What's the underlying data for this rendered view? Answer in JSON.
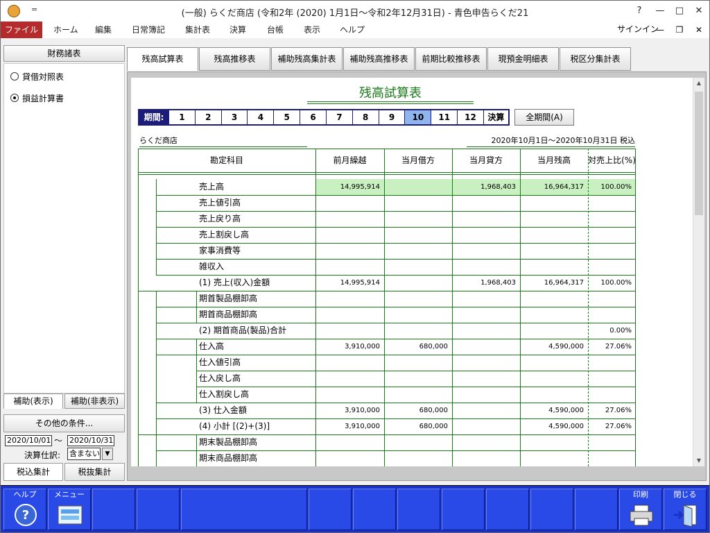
{
  "window": {
    "title": "(一般) らくだ商店 (令和2年 (2020) 1月1日～令和2年12月31日) - 青色申告らくだ21",
    "help_btn": "?",
    "min_btn": "—",
    "max_btn": "□",
    "close_btn": "✕",
    "qat": "="
  },
  "menu": {
    "items": [
      "ファイル",
      "ホーム",
      "編集",
      "日常簿記",
      "集計表",
      "決算",
      "台帳",
      "表示",
      "ヘルプ"
    ],
    "signin": "サインイン",
    "mdi_min": "—",
    "mdi_restore": "❐",
    "mdi_close": "✕"
  },
  "left": {
    "header": "財務諸表",
    "radios": [
      {
        "label": "貸借対照表",
        "selected": false
      },
      {
        "label": "損益計算書",
        "selected": true
      }
    ],
    "tab_show": "補助(表示)",
    "tab_hide": "補助(非表示)",
    "other_conditions": "その他の条件...",
    "date_from": "2020/10/01",
    "tilde": "～",
    "date_to": "2020/10/31",
    "settle_label": "決算仕訳:",
    "settle_value": "含まない",
    "tax_incl": "税込集計",
    "tax_excl": "税抜集計"
  },
  "tabs": [
    "残高試算表",
    "残高推移表",
    "補助残高集計表",
    "補助残高推移表",
    "前期比較推移表",
    "現預金明細表",
    "税区分集計表"
  ],
  "report": {
    "title": "残高試算表",
    "period_label": "期間:",
    "periods": [
      "1",
      "2",
      "3",
      "4",
      "5",
      "6",
      "7",
      "8",
      "9",
      "10",
      "11",
      "12",
      "決算"
    ],
    "current_period": "10",
    "all_period": "全期間(A)",
    "company": "らくだ商店",
    "date_range": "2020年10月1日～2020年10月31日  税込",
    "headers": [
      "勘定科目",
      "前月繰越",
      "当月借方",
      "当月貸方",
      "当月残高",
      "対売上比(%)"
    ],
    "rows": [
      {
        "name": "売上高",
        "cells": [
          "14,995,914",
          "",
          "1,968,403",
          "16,964,317",
          "100.00%"
        ]
      },
      {
        "name": "売上値引高",
        "cells": [
          "",
          "",
          "",
          "",
          ""
        ]
      },
      {
        "name": "売上戻り高",
        "cells": [
          "",
          "",
          "",
          "",
          ""
        ]
      },
      {
        "name": "売上割戻し高",
        "cells": [
          "",
          "",
          "",
          "",
          ""
        ]
      },
      {
        "name": "家事消費等",
        "cells": [
          "",
          "",
          "",
          "",
          ""
        ]
      },
      {
        "name": "雑収入",
        "cells": [
          "",
          "",
          "",
          "",
          ""
        ]
      },
      {
        "name": "(1) 売上(収入)金額",
        "cells": [
          "14,995,914",
          "",
          "1,968,403",
          "16,964,317",
          "100.00%"
        ]
      },
      {
        "name": "期首製品棚卸高",
        "cells": [
          "",
          "",
          "",
          "",
          ""
        ]
      },
      {
        "name": "期首商品棚卸高",
        "cells": [
          "",
          "",
          "",
          "",
          ""
        ]
      },
      {
        "name": "(2) 期首商品(製品)合計",
        "cells": [
          "",
          "",
          "",
          "",
          "0.00%"
        ]
      },
      {
        "name": "仕入高",
        "cells": [
          "3,910,000",
          "680,000",
          "",
          "4,590,000",
          "27.06%"
        ]
      },
      {
        "name": "仕入値引高",
        "cells": [
          "",
          "",
          "",
          "",
          ""
        ]
      },
      {
        "name": "仕入戻し高",
        "cells": [
          "",
          "",
          "",
          "",
          ""
        ]
      },
      {
        "name": "仕入割戻し高",
        "cells": [
          "",
          "",
          "",
          "",
          ""
        ]
      },
      {
        "name": "(3) 仕入金額",
        "cells": [
          "3,910,000",
          "680,000",
          "",
          "4,590,000",
          "27.06%"
        ]
      },
      {
        "name": "(4) 小計 [(2)+(3)]",
        "cells": [
          "3,910,000",
          "680,000",
          "",
          "4,590,000",
          "27.06%"
        ]
      },
      {
        "name": "期末製品棚卸高",
        "cells": [
          "",
          "",
          "",
          "",
          ""
        ]
      },
      {
        "name": "期末商品棚卸高",
        "cells": [
          "",
          "",
          "",
          "",
          ""
        ]
      }
    ]
  },
  "fbar": {
    "help": "ヘルプ",
    "menu": "メニュー",
    "print": "印刷",
    "close": "閉じる"
  }
}
